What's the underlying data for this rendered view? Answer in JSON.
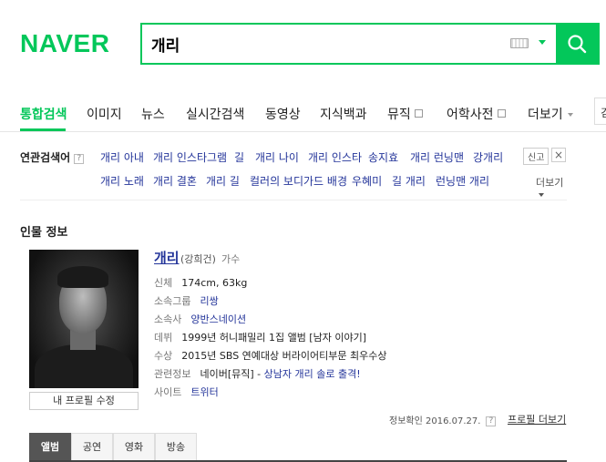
{
  "header": {
    "logo": "NAVER",
    "search_value": "개리",
    "colors": {
      "brand": "#03c75a",
      "link": "#24359a"
    }
  },
  "tabs": [
    {
      "label": "통합검색",
      "active": true
    },
    {
      "label": "이미지"
    },
    {
      "label": "뉴스"
    },
    {
      "label": "실시간검색"
    },
    {
      "label": "동영상"
    },
    {
      "label": "지식백과"
    },
    {
      "label": "뮤직"
    },
    {
      "label": "어학사전"
    },
    {
      "label": "더보기"
    }
  ],
  "tab_right_partial": "검",
  "related": {
    "label": "연관검색어",
    "help": "?",
    "row1": [
      "개리 아내",
      "개리 인스타그램",
      "길",
      "개리 나이",
      "개리 인스타",
      "송지효",
      "개리 런닝맨",
      "강개리"
    ],
    "row2": [
      "개리 노래",
      "개리 결혼",
      "개리 길",
      "컬러의 보디가드 배경",
      "우혜미",
      "길 개리",
      "런닝맨 개리"
    ],
    "report": "신고",
    "close": "×",
    "more": "더보기"
  },
  "person": {
    "section_title": "인물 정보",
    "name": "개리",
    "real_name": "(강희건)",
    "job": "가수",
    "edit_profile": "내 프로필 수정",
    "rows": [
      {
        "key": "신체",
        "value": "174cm, 63kg"
      },
      {
        "key": "소속그룹",
        "value": "리쌍",
        "link": true
      },
      {
        "key": "소속사",
        "value": "양반스네이션",
        "link": true
      },
      {
        "key": "데뷔",
        "value": "1999년 허니패밀리 1집 앨범 [남자 이야기]"
      },
      {
        "key": "수상",
        "value": "2015년 SBS 연예대상 버라이어티부문 최우수상"
      },
      {
        "key": "관련정보",
        "value": "네이버[뮤직] - 상남자 개리 솔로 출격!",
        "prefix": "네이버[뮤직] - ",
        "link_part": "상남자 개리 솔로 출격!"
      },
      {
        "key": "사이트",
        "value": "트위터",
        "link": true
      }
    ],
    "verified": "정보확인 2016.07.27.",
    "verified_help": "?",
    "profile_more": "프로필 더보기"
  },
  "subtabs": [
    {
      "label": "앨범",
      "active": true
    },
    {
      "label": "공연"
    },
    {
      "label": "영화"
    },
    {
      "label": "방송"
    }
  ]
}
